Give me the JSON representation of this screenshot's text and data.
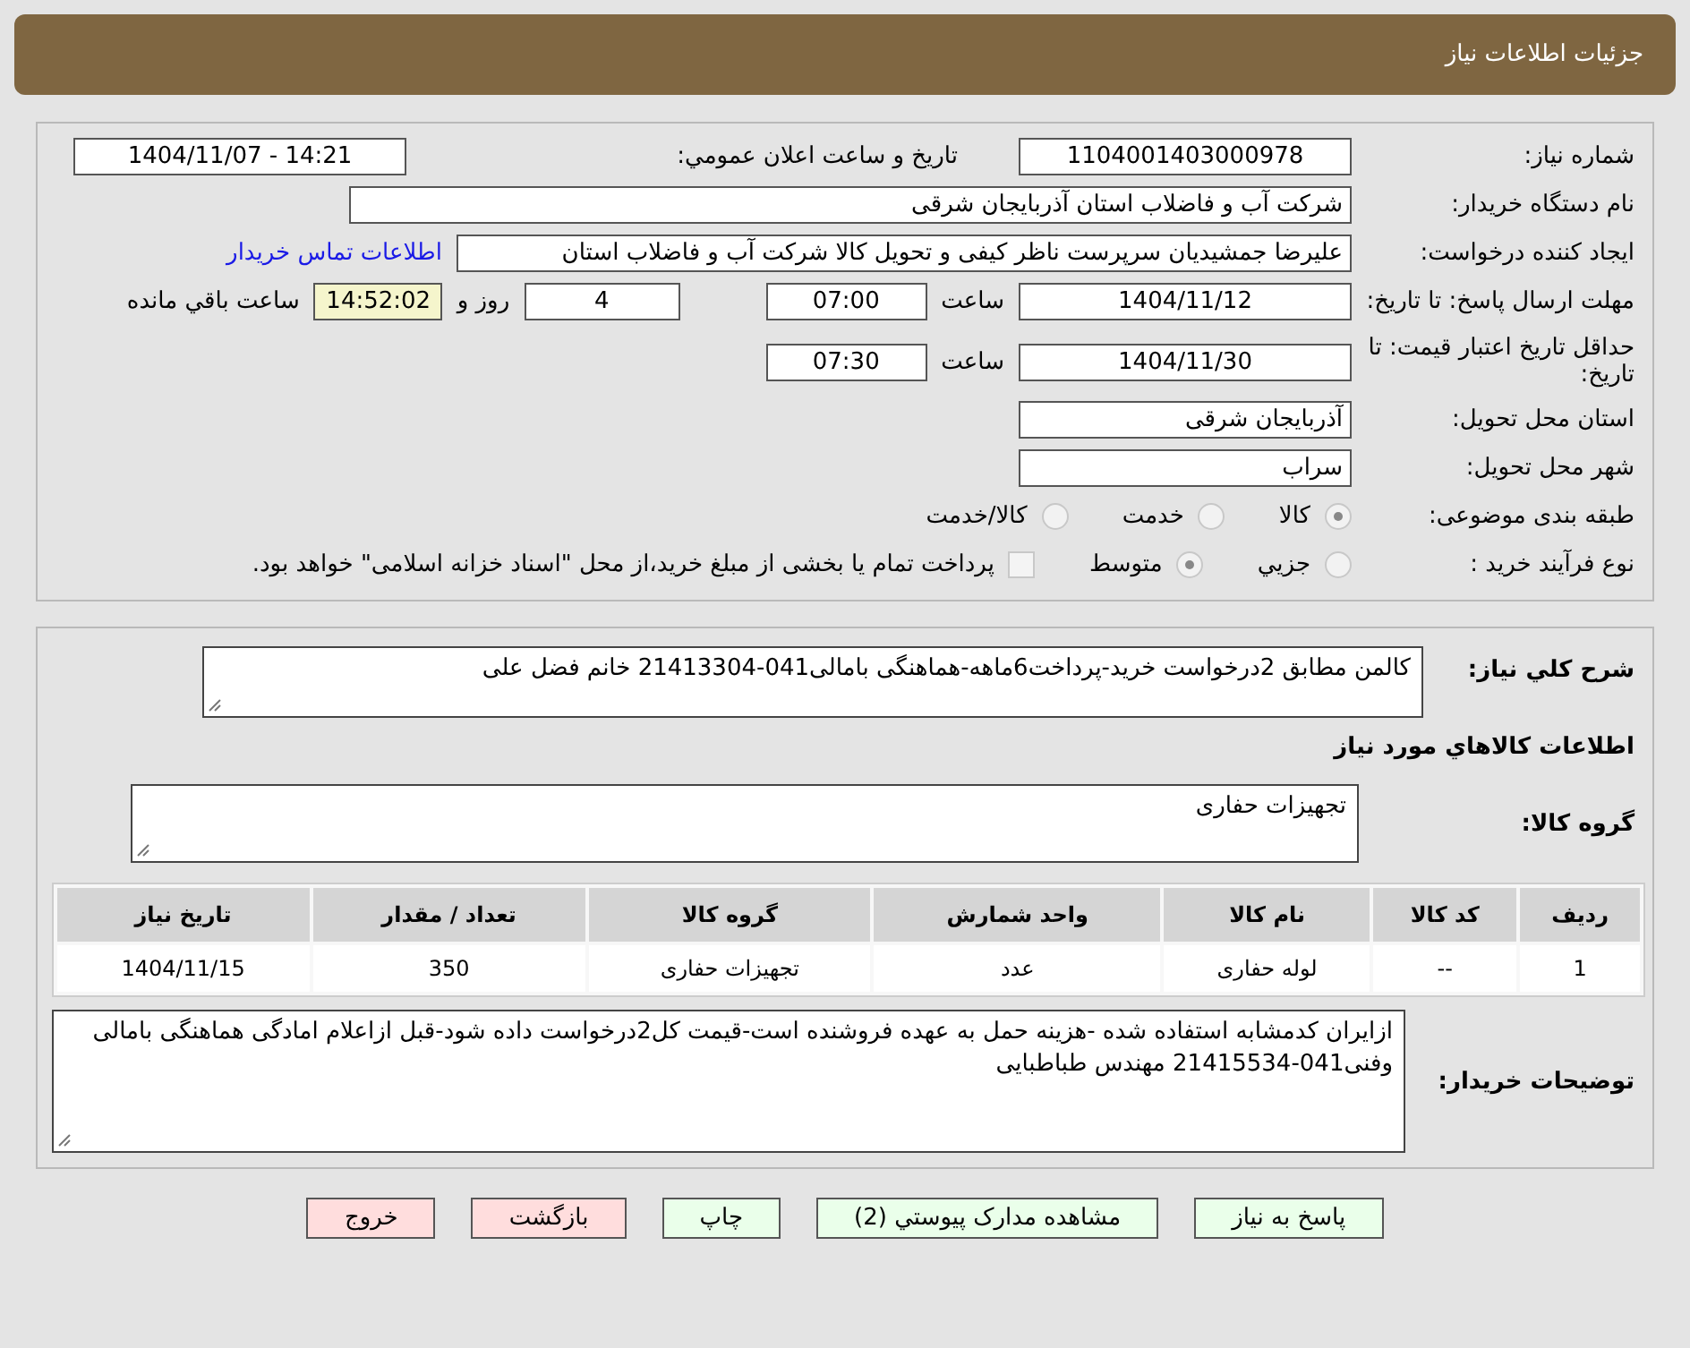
{
  "header": {
    "title": "جزئیات اطلاعات نیاز"
  },
  "need_number": {
    "label": "شماره نیاز:",
    "value": "1104001403000978"
  },
  "announce": {
    "label": "تاريخ و ساعت اعلان عمومي:",
    "value": "1404/11/07 - 14:21"
  },
  "buyer": {
    "label": "نام دستگاه خریدار:",
    "value": "شرکت آب و فاضلاب استان آذربایجان شرقی"
  },
  "creator": {
    "label": "ایجاد کننده درخواست:",
    "value": "علیرضا جمشیدیان سرپرست ناظر کیفی و تحویل کالا شرکت آب و فاضلاب استان",
    "link": "اطلاعات تماس خریدار"
  },
  "deadline": {
    "label": "مهلت ارسال پاسخ: تا تاریخ:",
    "date": "1404/11/12",
    "time_label": "ساعت",
    "time": "07:00",
    "days": "4",
    "days_label": "روز و",
    "remaining": "14:52:02",
    "remaining_label": "ساعت باقي مانده"
  },
  "validity": {
    "label": "حداقل تاريخ اعتبار قیمت: تا تاریخ:",
    "date": "1404/11/30",
    "time_label": "ساعت",
    "time": "07:30"
  },
  "province": {
    "label": "استان محل تحویل:",
    "value": "آذربایجان شرقی"
  },
  "city": {
    "label": "شهر محل تحویل:",
    "value": "سراب"
  },
  "category": {
    "label": "طبقه بندی موضوعی:",
    "options": [
      {
        "label": "کالا",
        "selected": true
      },
      {
        "label": "خدمت",
        "selected": false
      },
      {
        "label": "کالا/خدمت",
        "selected": false
      }
    ]
  },
  "process": {
    "label": "نوع فرآیند خرید :",
    "options": [
      {
        "label": "جزيي",
        "selected": false
      },
      {
        "label": "متوسط",
        "selected": true
      }
    ],
    "treasury": {
      "label": "پرداخت تمام یا بخشی از مبلغ خرید،از محل \"اسناد خزانه اسلامی\" خواهد بود.",
      "checked": false
    }
  },
  "summary": {
    "label": "شرح کلي نیاز:",
    "value": "کالمن مطابق 2درخواست خرید-پرداخت6ماهه-هماهنگی بامالی041-21413304 خانم فضل علی"
  },
  "goods_heading": "اطلاعات کالاهاي مورد نیاز",
  "goods_group": {
    "label": "گروه کالا:",
    "value": "تجهیزات حفاری"
  },
  "table": {
    "columns": [
      "ردیف",
      "کد کالا",
      "نام کالا",
      "واحد شمارش",
      "گروه کالا",
      "تعداد / مقدار",
      "تاریخ نیاز"
    ],
    "rows": [
      [
        "1",
        "--",
        "لوله حفاری",
        "عدد",
        "تجهیزات حفاری",
        "350",
        "1404/11/15"
      ]
    ]
  },
  "buyer_notes": {
    "label": "توضیحات خریدار:",
    "value": "ازایران کدمشابه استفاده شده -هزینه حمل به عهده فروشنده است-قیمت کل2درخواست داده شود-قبل ازاعلام امادگی هماهنگی بامالی وفنی041-21415534 مهندس طباطبایی"
  },
  "buttons": [
    {
      "label": "پاسخ به نیاز",
      "color": "#eaffea"
    },
    {
      "label": "مشاهده مدارک پیوستي (2)",
      "color": "#eaffea"
    },
    {
      "label": "چاپ",
      "color": "#eaffea"
    },
    {
      "label": "بازگشت",
      "color": "#ffdddd"
    },
    {
      "label": "خروج",
      "color": "#ffdddd"
    }
  ]
}
